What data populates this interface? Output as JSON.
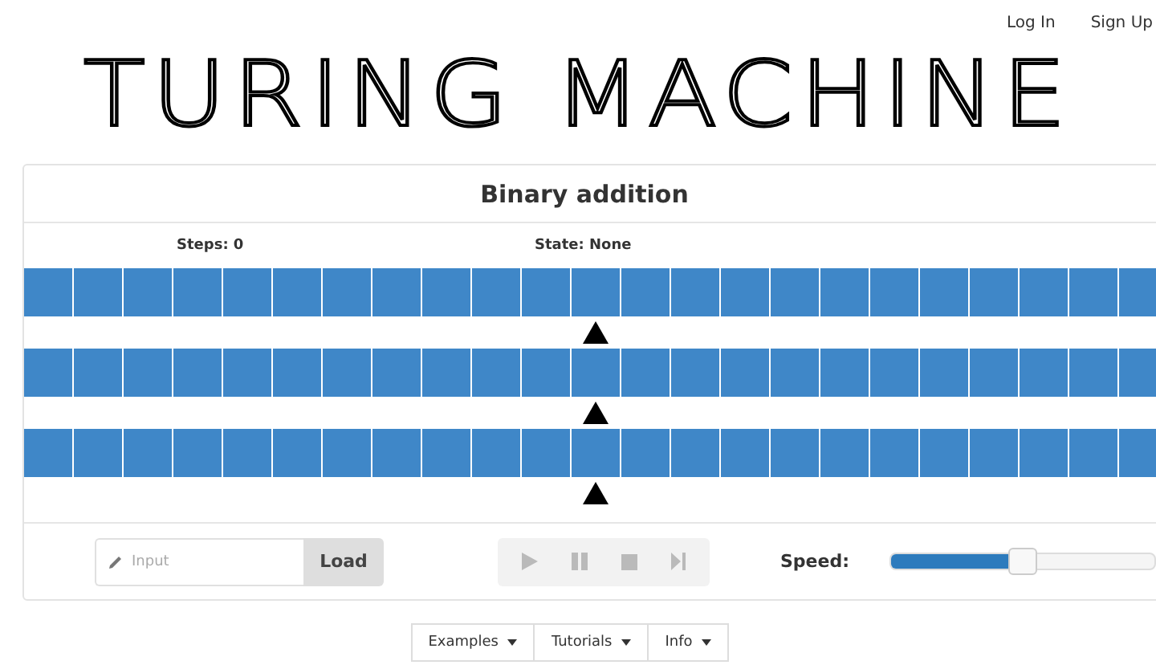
{
  "nav": [
    {
      "label": "Log In"
    },
    {
      "label": "Sign Up"
    }
  ],
  "logo": "TURING MACHINE",
  "panel": {
    "title": "Binary addition",
    "steps": "Steps: 0",
    "state": "State: None",
    "tapes": [
      {
        "cells": [
          {
            "head": false
          },
          {
            "head": false
          },
          {
            "head": false
          },
          {
            "head": false
          },
          {
            "head": false
          },
          {
            "head": false
          },
          {
            "head": false
          },
          {
            "head": false
          },
          {
            "head": false
          },
          {
            "head": false
          },
          {
            "head": false
          },
          {
            "head": true
          },
          {
            "head": false
          },
          {
            "head": false
          },
          {
            "head": false
          },
          {
            "head": false
          },
          {
            "head": false
          },
          {
            "head": false
          },
          {
            "head": false
          },
          {
            "head": false
          },
          {
            "head": false
          },
          {
            "head": false
          },
          {
            "head": false
          }
        ]
      },
      {
        "cells": [
          {
            "head": false
          },
          {
            "head": false
          },
          {
            "head": false
          },
          {
            "head": false
          },
          {
            "head": false
          },
          {
            "head": false
          },
          {
            "head": false
          },
          {
            "head": false
          },
          {
            "head": false
          },
          {
            "head": false
          },
          {
            "head": false
          },
          {
            "head": true
          },
          {
            "head": false
          },
          {
            "head": false
          },
          {
            "head": false
          },
          {
            "head": false
          },
          {
            "head": false
          },
          {
            "head": false
          },
          {
            "head": false
          },
          {
            "head": false
          },
          {
            "head": false
          },
          {
            "head": false
          },
          {
            "head": false
          }
        ]
      },
      {
        "cells": [
          {
            "head": false
          },
          {
            "head": false
          },
          {
            "head": false
          },
          {
            "head": false
          },
          {
            "head": false
          },
          {
            "head": false
          },
          {
            "head": false
          },
          {
            "head": false
          },
          {
            "head": false
          },
          {
            "head": false
          },
          {
            "head": false
          },
          {
            "head": true
          },
          {
            "head": false
          },
          {
            "head": false
          },
          {
            "head": false
          },
          {
            "head": false
          },
          {
            "head": false
          },
          {
            "head": false
          },
          {
            "head": false
          },
          {
            "head": false
          },
          {
            "head": false
          },
          {
            "head": false
          },
          {
            "head": false
          }
        ]
      }
    ],
    "input": {
      "placeholder": "Input",
      "button": "Load"
    },
    "player": [
      {
        "kind": "play",
        "disabled": true
      },
      {
        "kind": "pause",
        "disabled": true
      },
      {
        "kind": "stop",
        "disabled": true
      },
      {
        "kind": "step",
        "disabled": true
      }
    ],
    "speed": {
      "label": "Speed:",
      "level": 0.5
    }
  },
  "menu": [
    {
      "label": "Examples"
    },
    {
      "label": "Tutorials"
    },
    {
      "label": "Info"
    }
  ]
}
